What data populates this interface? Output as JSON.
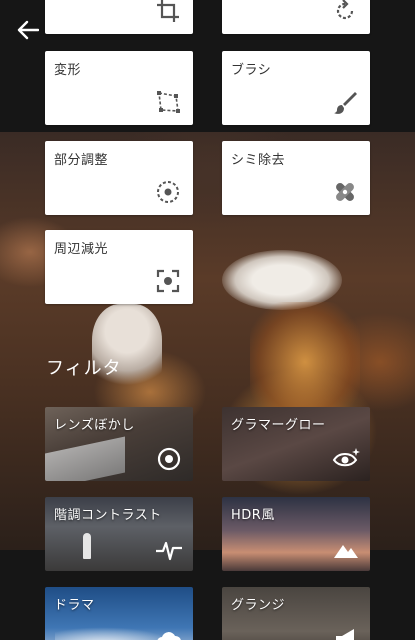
{
  "tools": [
    {
      "label": ""
    },
    {
      "label": ""
    },
    {
      "label": "変形"
    },
    {
      "label": "ブラシ"
    },
    {
      "label": "部分調整"
    },
    {
      "label": "シミ除去"
    },
    {
      "label": "周辺減光"
    }
  ],
  "filters_title": "フィルタ",
  "filters": [
    {
      "label": "レンズぼかし"
    },
    {
      "label": "グラマーグロー"
    },
    {
      "label": "階調コントラスト"
    },
    {
      "label": "HDR風"
    },
    {
      "label": "ドラマ"
    },
    {
      "label": "グランジ"
    }
  ]
}
